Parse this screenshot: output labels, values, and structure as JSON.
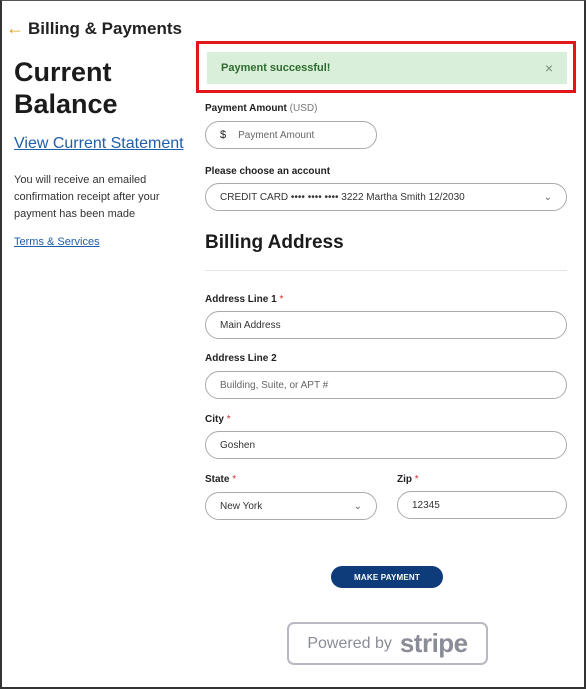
{
  "nav": {
    "back_label": "Billing & Payments"
  },
  "left": {
    "title": "Current Balance",
    "view_statement": "View Current Statement",
    "receipt_note": "You will receive an emailed confirmation receipt after your payment has been made",
    "terms": "Terms & Services"
  },
  "alert": {
    "message": "Payment successful!",
    "close": "×"
  },
  "payment": {
    "amount_label": "Payment Amount",
    "amount_unit": "(USD)",
    "currency_symbol": "$",
    "amount_placeholder": "Payment Amount",
    "account_label": "Please choose an account",
    "account_value": "CREDIT CARD •••• •••• •••• 3222 Martha Smith 12/2030"
  },
  "billing": {
    "heading": "Billing Address",
    "address1_label": "Address Line 1",
    "address1_value": "Main Address",
    "address2_label": "Address Line 2",
    "address2_placeholder": "Building, Suite, or APT #",
    "city_label": "City",
    "city_value": "Goshen",
    "state_label": "State",
    "state_value": "New York",
    "zip_label": "Zip",
    "zip_value": "12345",
    "required_mark": "*"
  },
  "actions": {
    "make_payment": "MAKE PAYMENT"
  },
  "footer": {
    "powered_by": "Powered by",
    "brand": "stripe"
  },
  "colors": {
    "accent": "#0e3c7a",
    "success_bg": "#d9efd9",
    "highlight": "#e0161b",
    "back_arrow": "#d4a017"
  }
}
